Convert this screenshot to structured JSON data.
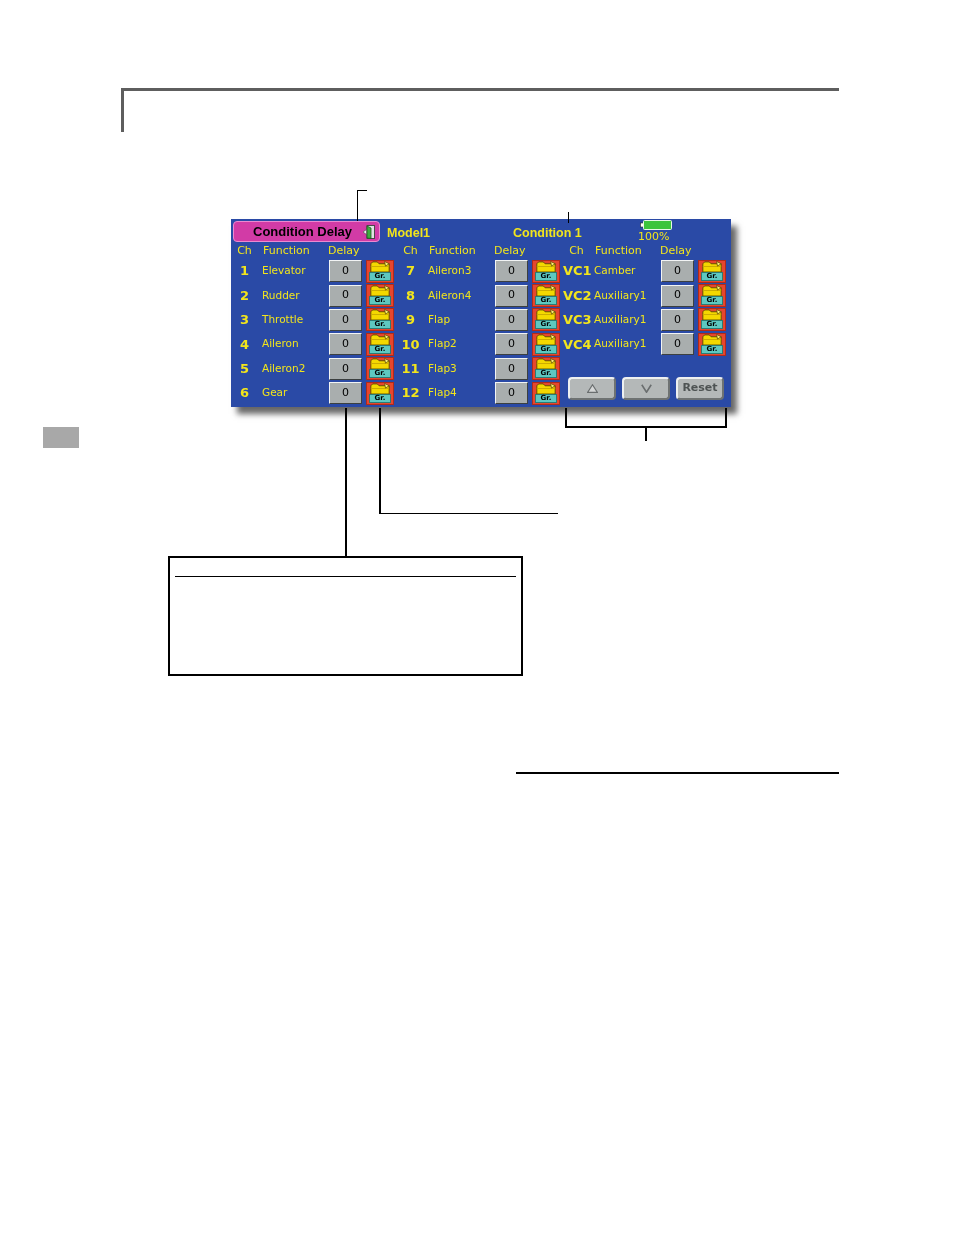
{
  "screen": {
    "title": "Condition Delay",
    "model": "Model1",
    "condition": "Condition 1",
    "battery_reading": "100%",
    "groups": [
      {
        "headers": [
          "Ch",
          "Function",
          "Delay"
        ],
        "rows": [
          {
            "ch": "1",
            "function": "Elevator",
            "delay": "0",
            "group_label": "Gr."
          },
          {
            "ch": "2",
            "function": "Rudder",
            "delay": "0",
            "group_label": "Gr."
          },
          {
            "ch": "3",
            "function": "Throttle",
            "delay": "0",
            "group_label": "Gr."
          },
          {
            "ch": "4",
            "function": "Aileron",
            "delay": "0",
            "group_label": "Gr."
          },
          {
            "ch": "5",
            "function": "Aileron2",
            "delay": "0",
            "group_label": "Gr."
          },
          {
            "ch": "6",
            "function": "Gear",
            "delay": "0",
            "group_label": "Gr."
          }
        ]
      },
      {
        "headers": [
          "Ch",
          "Function",
          "Delay"
        ],
        "rows": [
          {
            "ch": "7",
            "function": "Aileron3",
            "delay": "0",
            "group_label": "Gr."
          },
          {
            "ch": "8",
            "function": "Aileron4",
            "delay": "0",
            "group_label": "Gr."
          },
          {
            "ch": "9",
            "function": "Flap",
            "delay": "0",
            "group_label": "Gr."
          },
          {
            "ch": "10",
            "function": "Flap2",
            "delay": "0",
            "group_label": "Gr."
          },
          {
            "ch": "11",
            "function": "Flap3",
            "delay": "0",
            "group_label": "Gr."
          },
          {
            "ch": "12",
            "function": "Flap4",
            "delay": "0",
            "group_label": "Gr."
          }
        ]
      },
      {
        "headers": [
          "Ch",
          "Function",
          "Delay"
        ],
        "rows": [
          {
            "ch": "VC1",
            "function": "Camber",
            "delay": "0",
            "group_label": "Gr."
          },
          {
            "ch": "VC2",
            "function": "Auxiliary1",
            "delay": "0",
            "group_label": "Gr."
          },
          {
            "ch": "VC3",
            "function": "Auxiliary1",
            "delay": "0",
            "group_label": "Gr."
          },
          {
            "ch": "VC4",
            "function": "Auxiliary1",
            "delay": "0",
            "group_label": "Gr."
          }
        ],
        "buttons": [
          {
            "kind": "up",
            "disabled": true
          },
          {
            "kind": "down",
            "disabled": true
          },
          {
            "kind": "reset",
            "label": "Reset",
            "disabled": true
          }
        ]
      }
    ]
  }
}
